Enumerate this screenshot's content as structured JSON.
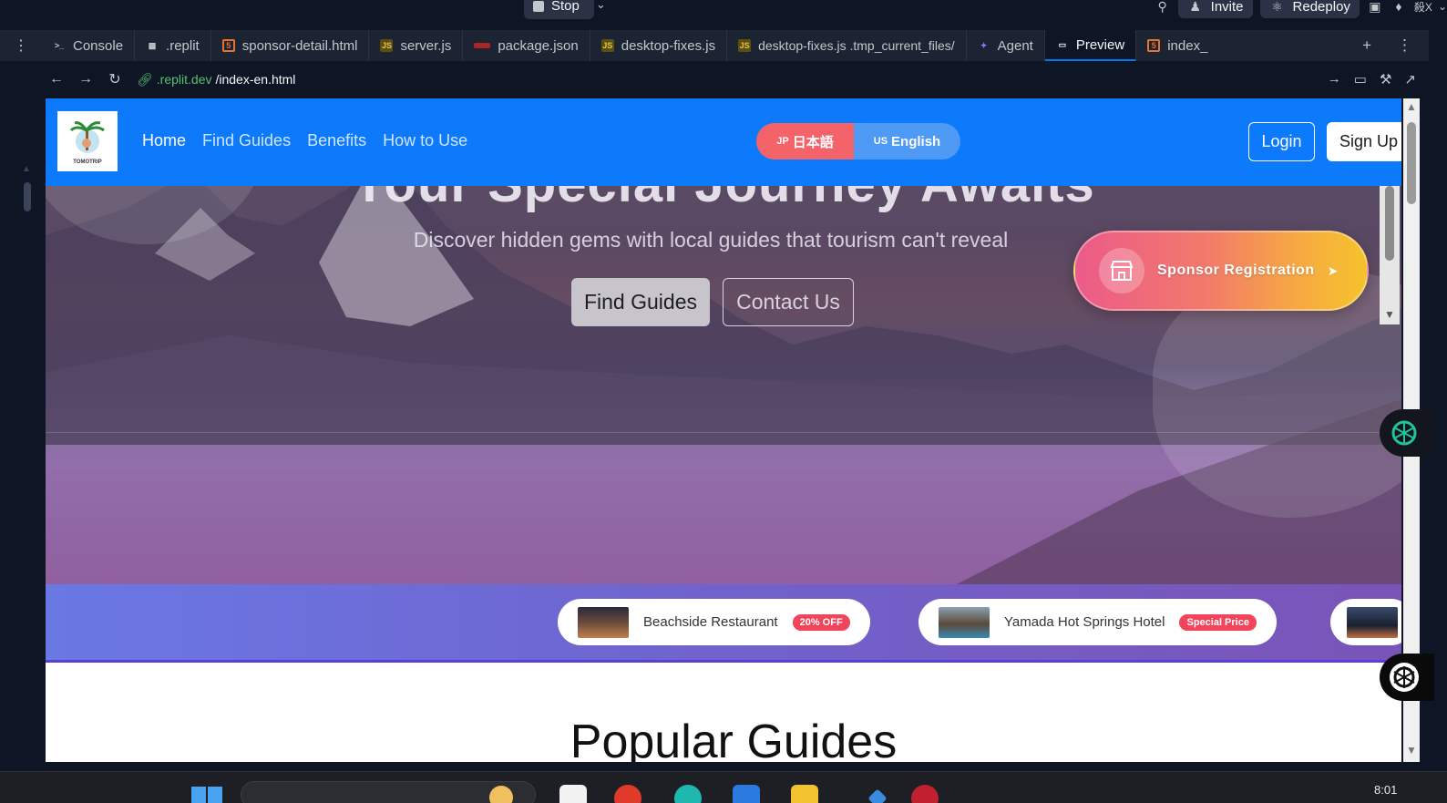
{
  "topbar": {
    "stop_label": "Stop",
    "invite_label": "Invite",
    "redeploy_label": "Redeploy",
    "avatar_text": "殺X"
  },
  "tabs": [
    {
      "label": "Console",
      "icon": "terminal-icon"
    },
    {
      "label": ".replit",
      "icon": "config-icon"
    },
    {
      "label": "sponsor-detail.html",
      "icon": "html-icon"
    },
    {
      "label": "server.js",
      "icon": "js-icon"
    },
    {
      "label": "package.json",
      "icon": "json-icon"
    },
    {
      "label": "desktop-fixes.js",
      "icon": "js-icon"
    },
    {
      "label": "desktop-fixes.js .tmp_current_files/",
      "icon": "js-icon"
    },
    {
      "label": "Agent",
      "icon": "agent-icon"
    },
    {
      "label": "Preview",
      "icon": "monitor-icon",
      "active": true
    },
    {
      "label": "index_",
      "icon": "html-icon"
    }
  ],
  "urlbar": {
    "host": ".replit.dev",
    "path": "/index-en.html"
  },
  "site": {
    "logo_text": "TOMOTRIP",
    "nav": [
      "Home",
      "Find Guides",
      "Benefits",
      "How to Use"
    ],
    "lang_jp_flag": "JP",
    "lang_jp": "日本語",
    "lang_en_flag": "US",
    "lang_en": "English",
    "login": "Login",
    "signup": "Sign Up",
    "hero_title": "Your Special Journey Awaits",
    "hero_subtitle": "Discover hidden gems with local guides that tourism can't reveal",
    "find_guides_btn": "Find Guides",
    "contact_btn": "Contact Us",
    "sponsor_label": "Sponsor Registration",
    "deals": [
      {
        "name": "Beachside Restaurant",
        "badge": "20% OFF"
      },
      {
        "name": "Yamada Hot Springs Hotel",
        "badge": "Special Price"
      }
    ],
    "popular_heading": "Popular Guides"
  },
  "taskbar": {
    "time": "8:01"
  },
  "colors": {
    "nav_blue": "#0d7afc",
    "lang_jp": "#f4626a",
    "lang_en": "#4f9af5",
    "badge_red": "#f2445a"
  }
}
